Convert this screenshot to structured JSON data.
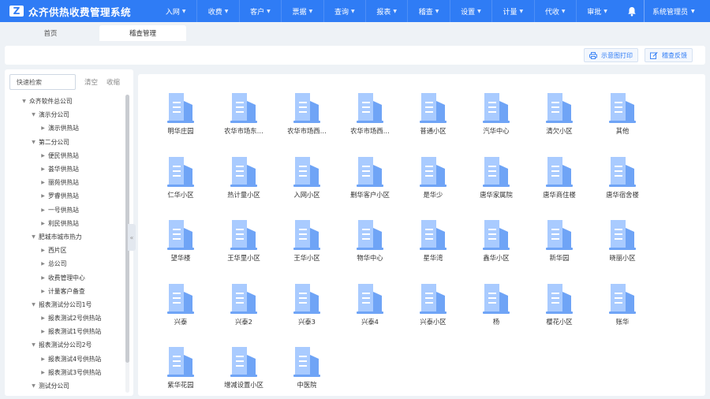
{
  "header": {
    "logo_letter": "Z",
    "title": "众齐供热收费管理系统",
    "nav": [
      {
        "label": "入网",
        "icon": "chevron-down-icon"
      },
      {
        "label": "收费",
        "icon": "chevron-down-icon"
      },
      {
        "label": "客户",
        "icon": "chevron-down-icon"
      },
      {
        "label": "票据",
        "icon": "chevron-down-icon"
      },
      {
        "label": "查询",
        "icon": "chevron-down-icon"
      },
      {
        "label": "报表",
        "icon": "chevron-down-icon"
      },
      {
        "label": "稽查",
        "icon": "chevron-down-icon"
      },
      {
        "label": "设置",
        "icon": "chevron-down-icon"
      },
      {
        "label": "计量",
        "icon": "chevron-down-icon"
      },
      {
        "label": "代收",
        "icon": "chevron-down-icon"
      },
      {
        "label": "审批",
        "icon": "chevron-down-icon"
      }
    ],
    "bell_icon": "bell-icon",
    "user": "系统管理员"
  },
  "tabs": [
    {
      "label": "首页"
    },
    {
      "label": "稽查管理"
    }
  ],
  "toolbar": {
    "print_label": "示意图打印",
    "feedback_label": "稽查反馈"
  },
  "sidebar": {
    "search_placeholder": "快速检索",
    "clear_label": "清空",
    "collapse_label": "收缩",
    "tree": [
      {
        "label": "众齐软件总公司",
        "level": 0,
        "expanded": true
      },
      {
        "label": "演示分公司",
        "level": 1,
        "expanded": true
      },
      {
        "label": "演示供热站",
        "level": 2,
        "expanded": false
      },
      {
        "label": "第二分公司",
        "level": 1,
        "expanded": true
      },
      {
        "label": "便民供热站",
        "level": 2,
        "expanded": false
      },
      {
        "label": "荟华供热站",
        "level": 2,
        "expanded": false
      },
      {
        "label": "丽苑供热站",
        "level": 2,
        "expanded": false
      },
      {
        "label": "罗睿供热站",
        "level": 2,
        "expanded": false
      },
      {
        "label": "一号供热站",
        "level": 2,
        "expanded": false
      },
      {
        "label": "利民供热站",
        "level": 2,
        "expanded": false
      },
      {
        "label": "肥城市城市热力",
        "level": 1,
        "expanded": true
      },
      {
        "label": "西片区",
        "level": 2,
        "expanded": false
      },
      {
        "label": "总公司",
        "level": 2,
        "expanded": false
      },
      {
        "label": "收费管理中心",
        "level": 2,
        "expanded": false
      },
      {
        "label": "计量客户备查",
        "level": 2,
        "expanded": false
      },
      {
        "label": "报表测试分公司1号",
        "level": 1,
        "expanded": true
      },
      {
        "label": "报表测试2号供热站",
        "level": 2,
        "expanded": false
      },
      {
        "label": "报表测试1号供热站",
        "level": 2,
        "expanded": false
      },
      {
        "label": "报表测试分公司2号",
        "level": 1,
        "expanded": true
      },
      {
        "label": "报表测试4号供热站",
        "level": 2,
        "expanded": false
      },
      {
        "label": "报表测试3号供热站",
        "level": 2,
        "expanded": false
      },
      {
        "label": "测试分公司",
        "level": 1,
        "expanded": true
      }
    ]
  },
  "communities": [
    "明华庄园",
    "农华市场东…",
    "农华市场西…",
    "农华市场西…",
    "普通小区",
    "汽华中心",
    "清欠小区",
    "其他",
    "仁华小区",
    "热计量小区",
    "入网小区",
    "删华客户小区",
    "是华少",
    "唐华家属院",
    "唐华商住楼",
    "唐华宿舍楼",
    "望华楼",
    "王华里小区",
    "王华小区",
    "物华中心",
    "星华湾",
    "鑫华小区",
    "新华园",
    "晓丽小区",
    "兴泰",
    "兴泰2",
    "兴泰3",
    "兴泰4",
    "兴泰小区",
    "杨",
    "樱花小区",
    "账华",
    "紫华花园",
    "增减设置小区",
    "中医院"
  ],
  "colors": {
    "primary": "#2f7cf5",
    "building_light": "#a9cbff",
    "building_dark": "#6fa4f6"
  }
}
